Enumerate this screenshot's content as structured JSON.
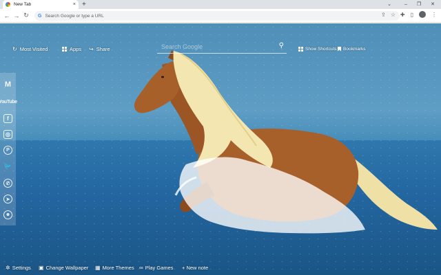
{
  "browser": {
    "tab_title": "New Tab",
    "tab_close": "×",
    "new_tab": "+",
    "window_controls": [
      "⌄",
      "–",
      "❐",
      "✕"
    ],
    "back": "←",
    "forward": "→",
    "reload": "↻",
    "omnibox_placeholder": "Search Google or type a URL",
    "omnibox_g": "G",
    "share_icon": "⇪",
    "star_icon": "☆",
    "extensions_icon": "✚",
    "sidepanel_icon": "▯",
    "menu_icon": "⋮"
  },
  "top_bar": {
    "most_visited": "Most Visited",
    "apps": "Apps",
    "share": "Share",
    "search_placeholder": "Search Google",
    "search_icon": "⚲",
    "show_shortcuts": "Show Shortcuts",
    "bookmarks": "Bookmarks",
    "most_visited_icon": "↻",
    "share_icon": "↪"
  },
  "sidebar": {
    "items": [
      {
        "name": "gmail",
        "glyph": "M"
      },
      {
        "name": "youtube",
        "glyph": "YouTube"
      },
      {
        "name": "facebook",
        "glyph": "f"
      },
      {
        "name": "instagram",
        "glyph": "◎"
      },
      {
        "name": "pinterest",
        "glyph": "P"
      },
      {
        "name": "twitter",
        "glyph": "🐦"
      },
      {
        "name": "whatsapp",
        "glyph": "✆"
      },
      {
        "name": "telegram",
        "glyph": "➤"
      },
      {
        "name": "reddit",
        "glyph": "☻"
      }
    ]
  },
  "bottom_bar": {
    "settings": "Settings",
    "change_wallpaper": "Change Wallpaper",
    "more_themes": "More Themes",
    "play_games": "Play Games",
    "new_note": "+ New note",
    "settings_icon": "✲",
    "wallpaper_icon": "▣",
    "themes_icon": "▦",
    "games_icon": "∞"
  },
  "colors": {
    "sky": "#5e9dc4",
    "sea": "#2366a0",
    "horse": "#a8602a",
    "mane": "#f3e6b0"
  }
}
